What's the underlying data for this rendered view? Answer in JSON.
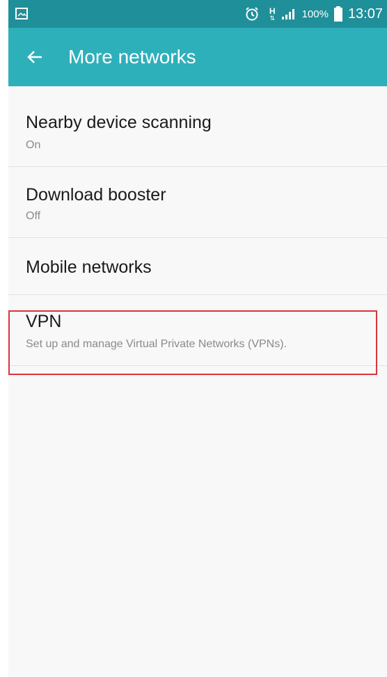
{
  "status_bar": {
    "battery_percent": "100%",
    "time": "13:07",
    "network_type": "H",
    "icons": [
      "gallery-icon",
      "alarm-icon",
      "network-type-icon",
      "signal-icon",
      "battery-icon"
    ]
  },
  "app_bar": {
    "title": "More networks",
    "back_icon": "back-arrow-icon"
  },
  "items": [
    {
      "title": "Nearby device scanning",
      "subtitle": "On"
    },
    {
      "title": "Download booster",
      "subtitle": "Off"
    },
    {
      "title": "Mobile networks",
      "subtitle": ""
    },
    {
      "title": "VPN",
      "subtitle": "Set up and manage Virtual Private Networks (VPNs)."
    }
  ],
  "colors": {
    "status_bar": "#1f8f99",
    "app_bar": "#2eb0bb",
    "background": "#f8f8f8",
    "highlight_box": "#d8343f"
  }
}
